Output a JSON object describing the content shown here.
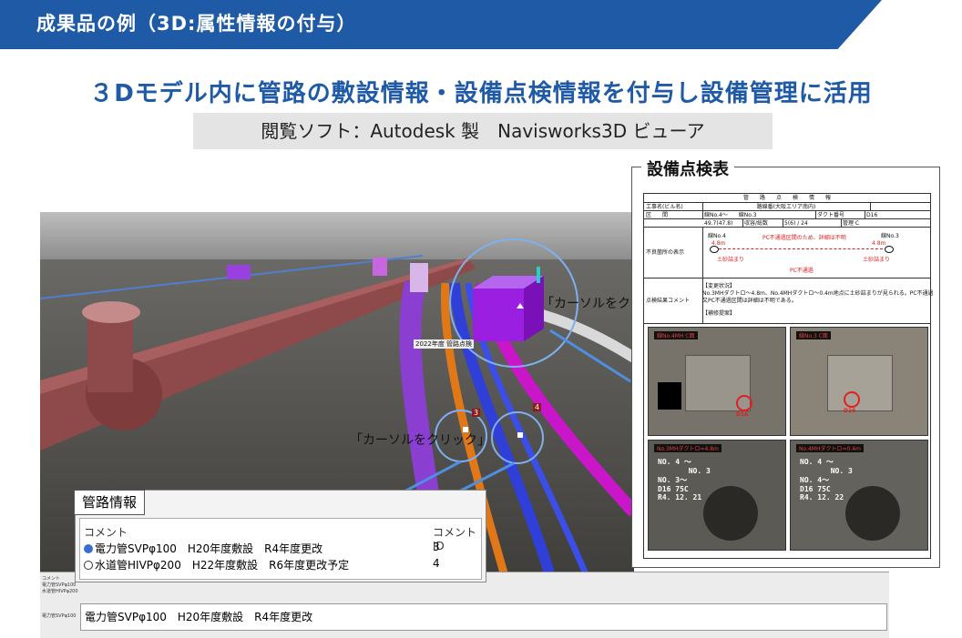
{
  "banner": {
    "title": "成果品の例（3D:属性情報の付与）"
  },
  "headline": "３Dモデル内に管路の敷設情報・設備点検情報を付与し設備管理に活用",
  "software_label": "閲覧ソフト：Autodesk 製　Navisworks3D ビューア",
  "viewport": {
    "callout_top": "「カーソルをクリッ",
    "callout_left": "「カーソルをクリック」",
    "tag": "2022年度 管路点検",
    "mark_a": "3",
    "mark_b": "4"
  },
  "inspection": {
    "title": "設備点検表",
    "sheet_header": "管　　路　　点　　検　　情　　報",
    "row_work": "工事名(ビル名)",
    "row_work_val": "路線番(大阪エリア南内)",
    "row_section": "区　　間",
    "row_section_val": "線No.4〜　　線No.3",
    "row_duct": "ダクト番号",
    "row_duct_val": "D16",
    "row_len": "49.7(47.8)",
    "row_len_label": "収容/総数",
    "row_len_val": "5(6) / 24",
    "row_mgr": "管理 C",
    "defect_label": "不良箇所の表示",
    "defect_left": "線No.4",
    "defect_right": "線No.3",
    "defect_note": "PC不通過区間のため、詳細は不明",
    "defect_dist1": "4.8m",
    "defect_dist2": "4.8m",
    "defect_sand1": "土砂詰まり",
    "defect_sand2": "土砂詰まり",
    "defect_pc": "PC不通過",
    "result_label": "点検結果コメント",
    "result_heading": "【変更状況】",
    "result_line1": "No.3MHダクトロ～4.8m、No.4MHダクトロ～0.4m地点に土砂詰まりが見られる。PC不通過",
    "result_line2": "又PC不通過区間は詳細は不明である。",
    "result_repair": "【補修提案】",
    "photo1_cap": "線No.4MH C面",
    "photo2_cap": "線No.3 C面",
    "photo3_cap": "No.3MHダクトロ=4.8m",
    "photo4_cap": "No.4MHダクトロ=0.4m",
    "photo_tag": "D16",
    "photo3_text": "NO. 4 ～\n       NO. 3\nNO. 3～\nD16 75C\nR4. 12. 21",
    "photo4_text": "NO. 4 ～\n       NO. 3\nNO. 4～\nD16 75C\nR4. 12. 22"
  },
  "pipe_panel": {
    "tab": "管路情報",
    "col_comment": "コメント",
    "col_id": "コメント ID",
    "rows": [
      {
        "text": "電力管SVPφ100　H20年度敷設　R4年度更改",
        "id": "3"
      },
      {
        "text": "水道管HIVPφ200　H22年度敷設　R6年度更改予定",
        "id": "4"
      }
    ],
    "status": "電力管SVPφ100　H20年度敷設　R4年度更改",
    "mini_lines": [
      "コメント",
      "電力管SVPφ100",
      "水道管HIVPφ200",
      "電力管SVPφ100"
    ]
  },
  "colors": {
    "banner": "#1f5aa6",
    "headline": "#1f5aa6",
    "pipe_purple": "#8a3fd1",
    "pipe_orange": "#e07818",
    "pipe_blue": "#2f3fd8",
    "pipe_magenta": "#c816c8",
    "pipe_red": "#8e4a4a",
    "callout": "#4f8fe0"
  }
}
